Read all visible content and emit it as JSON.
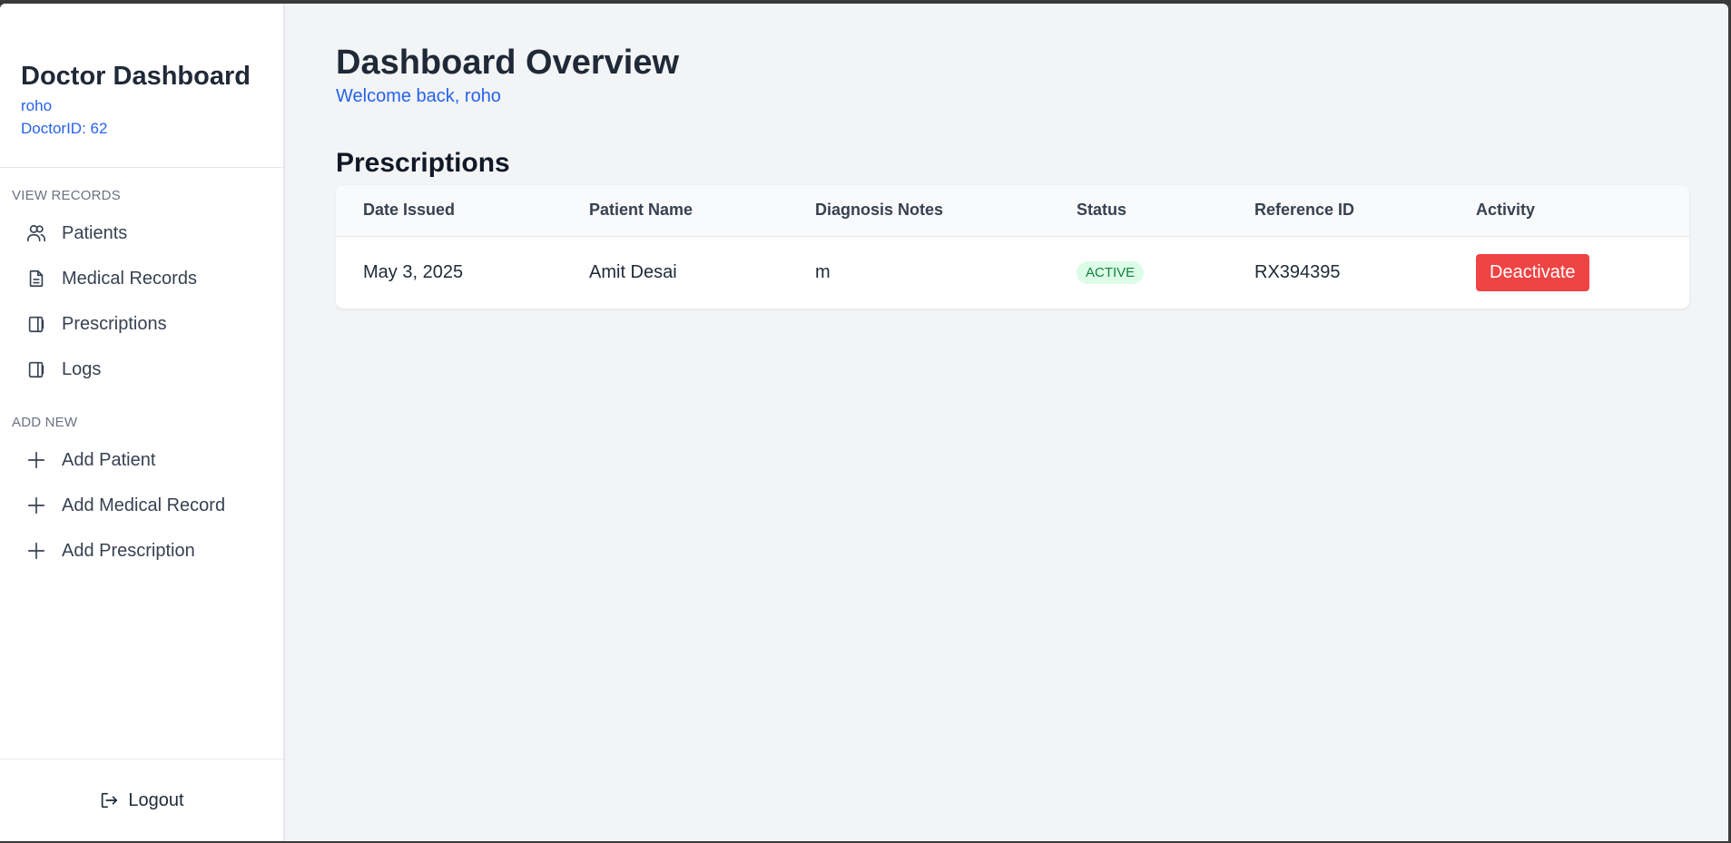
{
  "sidebar": {
    "title": "Doctor Dashboard",
    "username": "roho",
    "doctor_id": "DoctorID: 62",
    "view_label": "VIEW RECORDS",
    "view_items": [
      {
        "label": "Patients",
        "icon": "users-icon"
      },
      {
        "label": "Medical Records",
        "icon": "document-icon"
      },
      {
        "label": "Prescriptions",
        "icon": "clipboard-icon"
      },
      {
        "label": "Logs",
        "icon": "clipboard-icon"
      }
    ],
    "add_label": "ADD NEW",
    "add_items": [
      {
        "label": "Add Patient",
        "icon": "plus-icon"
      },
      {
        "label": "Add Medical Record",
        "icon": "plus-icon"
      },
      {
        "label": "Add Prescription",
        "icon": "plus-icon"
      }
    ],
    "logout_label": "Logout"
  },
  "main": {
    "title": "Dashboard Overview",
    "welcome": "Welcome back, roho",
    "section_title": "Prescriptions",
    "table": {
      "headers": [
        "Date Issued",
        "Patient Name",
        "Diagnosis Notes",
        "Status",
        "Reference ID",
        "Activity"
      ],
      "rows": [
        {
          "date": "May 3, 2025",
          "patient": "Amit Desai",
          "notes": "m",
          "status": "ACTIVE",
          "reference": "RX394395",
          "action": "Deactivate"
        }
      ]
    }
  },
  "colors": {
    "accent": "#2563eb",
    "danger": "#ef4444",
    "status_active_bg": "#dcfce7",
    "status_active_text": "#15803d"
  }
}
